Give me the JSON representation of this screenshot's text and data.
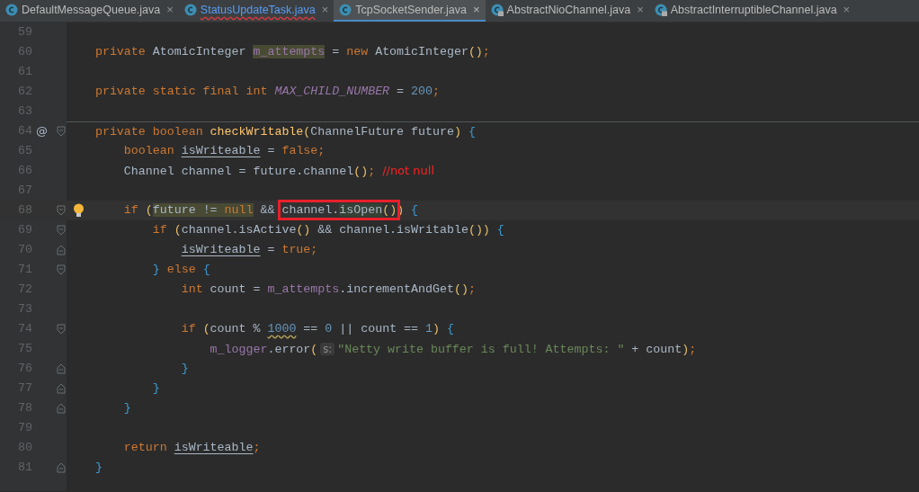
{
  "tabs": [
    {
      "label": "DefaultMessageQueue.java",
      "kind": "class",
      "selected": false,
      "error": false,
      "close": "×"
    },
    {
      "label": "StatusUpdateTask.java",
      "kind": "class",
      "selected": false,
      "error": true,
      "close": "×"
    },
    {
      "label": "TcpSocketSender.java",
      "kind": "class",
      "selected": true,
      "error": false,
      "close": "×"
    },
    {
      "label": "AbstractNioChannel.java",
      "kind": "locked",
      "selected": false,
      "error": false,
      "close": "×"
    },
    {
      "label": "AbstractInterruptibleChannel.java",
      "kind": "locked",
      "selected": false,
      "error": false,
      "close": "×"
    }
  ],
  "lines": [
    {
      "number": "59"
    },
    {
      "number": "60",
      "tokens": [
        {
          "text": "    private ",
          "kind": "kw"
        },
        {
          "text": "AtomicInteger "
        },
        {
          "text": "m_attempts",
          "kind": "field",
          "highlighted": true
        },
        {
          "text": " = "
        },
        {
          "text": "new ",
          "kind": "kw"
        },
        {
          "text": "AtomicInteger"
        },
        {
          "text": "()",
          "kind": "paren"
        },
        {
          "text": ";",
          "kind": "kw"
        }
      ]
    },
    {
      "number": "61"
    },
    {
      "number": "62",
      "tokens": [
        {
          "text": "    private static final int ",
          "kind": "kw"
        },
        {
          "text": "MAX_CHILD_NUMBER",
          "kind": "const"
        },
        {
          "text": " = "
        },
        {
          "text": "200",
          "kind": "num"
        },
        {
          "text": ";",
          "kind": "kw"
        }
      ]
    },
    {
      "number": "63"
    },
    {
      "number": "64",
      "separator": true,
      "marker": "@",
      "fold_start": true,
      "tokens": [
        {
          "text": "    private boolean ",
          "kind": "kw"
        },
        {
          "text": "checkWritable",
          "kind": "fn"
        },
        {
          "text": "(",
          "kind": "paren"
        },
        {
          "text": "ChannelFuture future"
        },
        {
          "text": ")",
          "kind": "paren"
        },
        {
          "text": " {",
          "kind": "brace"
        }
      ]
    },
    {
      "number": "65",
      "tokens": [
        {
          "text": "        boolean ",
          "kind": "kw"
        },
        {
          "text": "isWriteable",
          "underline": true
        },
        {
          "text": " = "
        },
        {
          "text": "false;",
          "kind": "kw"
        }
      ]
    },
    {
      "number": "66",
      "tokens": [
        {
          "text": "        Channel channel = future.channel"
        },
        {
          "text": "()",
          "kind": "paren"
        },
        {
          "text": "; ",
          "kind": "kw"
        },
        {
          "text": "//not null",
          "kind": "note"
        }
      ]
    },
    {
      "number": "67"
    },
    {
      "number": "68",
      "current": true,
      "bulb": true,
      "fold_start": true,
      "tokens": [
        {
          "text": "        if ",
          "kind": "kw"
        },
        {
          "text": "(",
          "kind": "paren"
        },
        {
          "text": "future != ",
          "highlighted": true
        },
        {
          "text": "null",
          "kind": "kw",
          "highlighted": true
        },
        {
          "text": " && "
        },
        {
          "text": "channel.",
          "boxed": true
        },
        {
          "text": "isOpen",
          "boxed": true,
          "matched": true
        },
        {
          "text": "()",
          "kind": "paren",
          "boxed": true
        },
        {
          "text": ")",
          "kind": "paren"
        },
        {
          "text": " {",
          "kind": "brace"
        }
      ]
    },
    {
      "number": "69",
      "fold_start": true,
      "tokens": [
        {
          "text": "            if ",
          "kind": "kw"
        },
        {
          "text": "(",
          "kind": "paren"
        },
        {
          "text": "channel.isActive"
        },
        {
          "text": "()",
          "kind": "paren"
        },
        {
          "text": " && channel.isWritable"
        },
        {
          "text": "())",
          "kind": "paren"
        },
        {
          "text": " {",
          "kind": "brace"
        }
      ]
    },
    {
      "number": "70",
      "fold_end": true,
      "tokens": [
        {
          "text": "                isWriteable",
          "underline": true
        },
        {
          "text": " = "
        },
        {
          "text": "true;",
          "kind": "kw"
        }
      ]
    },
    {
      "number": "71",
      "fold_start": true,
      "tokens": [
        {
          "text": "            }",
          "kind": "brace"
        },
        {
          "text": " else ",
          "kind": "kw"
        },
        {
          "text": "{",
          "kind": "brace"
        }
      ]
    },
    {
      "number": "72",
      "tokens": [
        {
          "text": "                int ",
          "kind": "kw"
        },
        {
          "text": "count = "
        },
        {
          "text": "m_attempts",
          "kind": "field"
        },
        {
          "text": ".incrementAndGet"
        },
        {
          "text": "()",
          "kind": "paren"
        },
        {
          "text": ";",
          "kind": "kw"
        }
      ]
    },
    {
      "number": "73"
    },
    {
      "number": "74",
      "fold_start": true,
      "tokens": [
        {
          "text": "                if ",
          "kind": "kw"
        },
        {
          "text": "(",
          "kind": "paren"
        },
        {
          "text": "count % "
        },
        {
          "text": "1000",
          "kind": "num",
          "wavy": true
        },
        {
          "text": " == "
        },
        {
          "text": "0",
          "kind": "num"
        },
        {
          "text": " || count == "
        },
        {
          "text": "1",
          "kind": "num"
        },
        {
          "text": ")",
          "kind": "paren"
        },
        {
          "text": " {",
          "kind": "brace"
        }
      ]
    },
    {
      "number": "75",
      "tokens": [
        {
          "text": "                    m_logger",
          "kind": "field"
        },
        {
          "text": ".error"
        },
        {
          "text": "(",
          "kind": "paren"
        },
        {
          "text": "s:",
          "kind": "hint"
        },
        {
          "text": "\"Netty write buffer is full! Attempts: \"",
          "kind": "str"
        },
        {
          "text": " + count"
        },
        {
          "text": ")",
          "kind": "paren"
        },
        {
          "text": ";",
          "kind": "kw"
        }
      ]
    },
    {
      "number": "76",
      "fold_end": true,
      "tokens": [
        {
          "text": "                }",
          "kind": "brace"
        }
      ]
    },
    {
      "number": "77",
      "fold_end": true,
      "tokens": [
        {
          "text": "            }",
          "kind": "brace"
        }
      ]
    },
    {
      "number": "78",
      "fold_end": true,
      "tokens": [
        {
          "text": "        }",
          "kind": "brace"
        }
      ]
    },
    {
      "number": "79"
    },
    {
      "number": "80",
      "tokens": [
        {
          "text": "        return ",
          "kind": "kw"
        },
        {
          "text": "isWriteable",
          "underline": true
        },
        {
          "text": ";",
          "kind": "kw"
        }
      ]
    },
    {
      "number": "81",
      "fold_end": true,
      "tokens": [
        {
          "text": "    }",
          "kind": "brace"
        }
      ]
    }
  ]
}
